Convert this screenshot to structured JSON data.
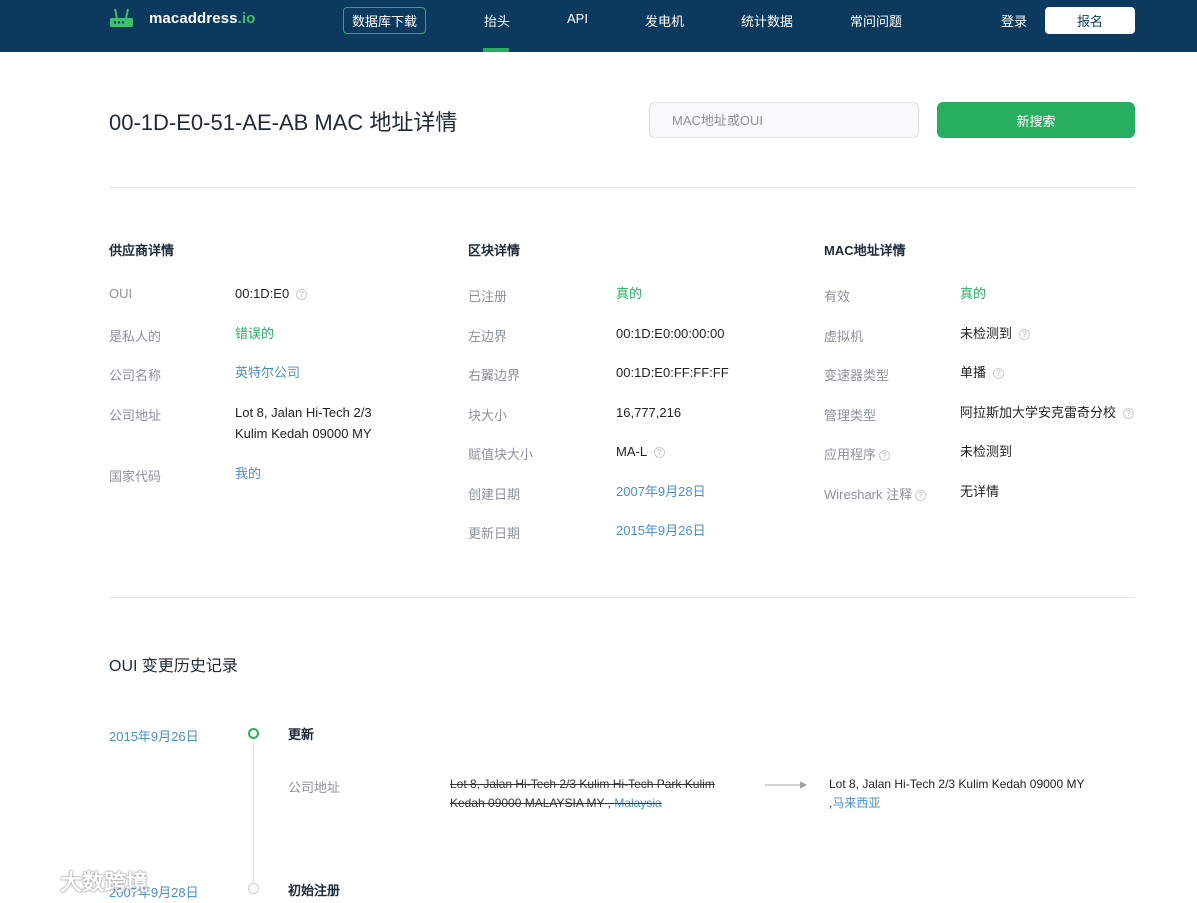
{
  "header": {
    "logo_text": "macaddress",
    "logo_tld": ".io",
    "db_download": "数据库下载",
    "nav": [
      "抬头",
      "API",
      "发电机",
      "统计数据",
      "常问问题"
    ],
    "login": "登录",
    "signup": "报名"
  },
  "title": "00-1D-E0-51-AE-AB MAC 地址详情",
  "search": {
    "placeholder": "MAC地址或OUI",
    "button": "新搜索"
  },
  "vendor": {
    "title": "供应商详情",
    "oui_label": "OUI",
    "oui_value": "00:1D:E0",
    "private_label": "是私人的",
    "private_value": "错误的",
    "company_label": "公司名称",
    "company_value": "英特尔公司",
    "address_label": "公司地址",
    "address_line1": "Lot 8, Jalan Hi-Tech 2/3",
    "address_line2": "Kulim Kedah 09000 MY",
    "country_label": "国家代码",
    "country_value": "我的"
  },
  "block": {
    "title": "区块详情",
    "registered_label": "已注册",
    "registered_value": "真的",
    "left_label": "左边界",
    "left_value": "00:1D:E0:00:00:00",
    "right_label": "右翼边界",
    "right_value": "00:1D:E0:FF:FF:FF",
    "size_label": "块大小",
    "size_value": "16,777,216",
    "assign_label": "赋值块大小",
    "assign_value": "MA-L",
    "created_label": "创建日期",
    "created_value": "2007年9月28日",
    "updated_label": "更新日期",
    "updated_value": "2015年9月26日"
  },
  "mac": {
    "title": "MAC地址详情",
    "valid_label": "有效",
    "valid_value": "真的",
    "vm_label": "虚拟机",
    "vm_value": "未检测到",
    "transmission_label": "变速器类型",
    "transmission_value": "单播",
    "admin_label": "管理类型",
    "admin_value": "阿拉斯加大学安克雷奇分校",
    "app_label": "应用程序",
    "app_value": "未检测到",
    "wireshark_label": "Wireshark 注释",
    "wireshark_value": "无详情"
  },
  "history": {
    "title": "OUI 变更历史记录",
    "entries": [
      {
        "date": "2015年9月26日",
        "event": "更新",
        "field": "公司地址",
        "old": "Lot 8, Jalan Hi-Tech 2/3 Kulim Hi-Tech Park Kulim Kedah 09000 MALAYSIA MY",
        "old_country": "Malaysia",
        "new": "Lot 8, Jalan Hi-Tech 2/3 Kulim Kedah 09000 MY",
        "new_country": "马来西亚"
      },
      {
        "date": "2007年9月28日",
        "event": "初始注册"
      }
    ]
  },
  "watermark": "大数跨境",
  "colors": {
    "header_bg": "#0c3a5e",
    "accent_green": "#27ae60",
    "link_blue": "#4a90c8"
  }
}
